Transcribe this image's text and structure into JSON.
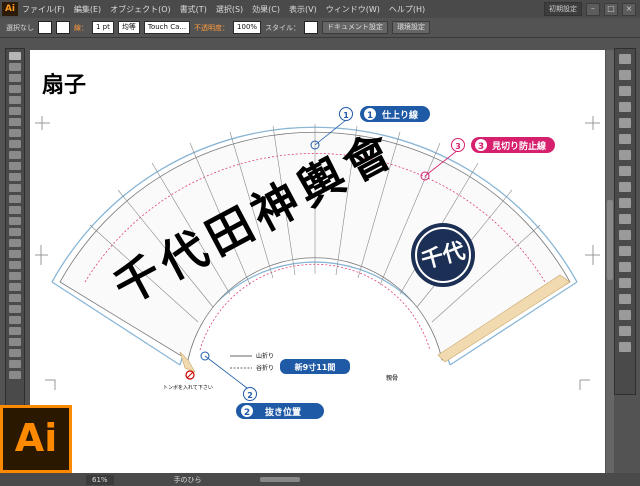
{
  "menubar": {
    "logo": "Ai",
    "items": [
      "ファイル(F)",
      "編集(E)",
      "オブジェクト(O)",
      "書式(T)",
      "選択(S)",
      "効果(C)",
      "表示(V)",
      "ウィンドウ(W)",
      "ヘルプ(H)"
    ],
    "workspace": "初期設定"
  },
  "control_bar": {
    "selection_status": "選択なし",
    "stroke_label": "線：",
    "stroke_weight": "1 pt",
    "stroke_profile": "均等",
    "brush_name": "Touch Ca...",
    "opacity_label": "不透明度：",
    "opacity_value": "100%",
    "style_label": "スタイル：",
    "document_setup_button": "ドキュメント設定",
    "preferences_button": "環境設定"
  },
  "document": {
    "title": "扇子",
    "fan_text": "千代田神輿會",
    "callout_1_number": "1",
    "callout_1_label": "仕上り線",
    "callout_2_number": "2",
    "callout_2_label": "抜き位置",
    "callout_3_number": "3",
    "callout_3_label": "見切り防止線",
    "legend_mountain": "山折り",
    "legend_valley": "谷折り",
    "size_badge": "新9寸11間",
    "pin_note": "トンボを入れて下さい",
    "parent_bone_note": "親骨",
    "crest_kanji": "千代"
  },
  "colors": {
    "callout_blue": "#1f5aa6",
    "callout_magenta": "#d6206e",
    "crest_navy": "#1c2f55",
    "trim_line": "#8ab6d6",
    "safety_line": "#e0407a"
  },
  "bottombar": {
    "zoom": "61%",
    "status": "手のひら"
  }
}
